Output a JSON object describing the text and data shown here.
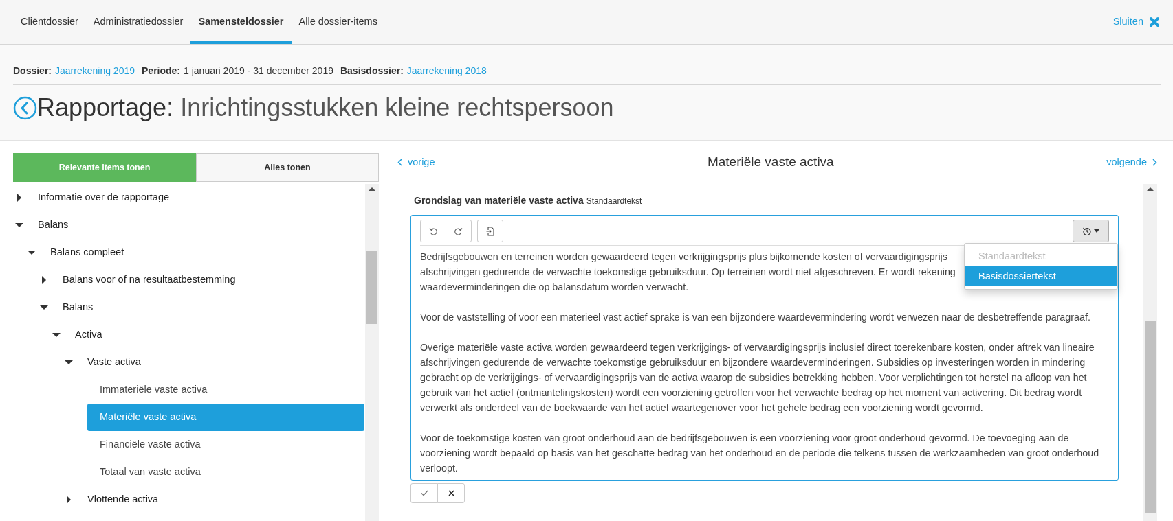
{
  "nav": {
    "tabs": [
      {
        "label": "Cliëntdossier",
        "selected": false
      },
      {
        "label": "Administratiedossier",
        "selected": false
      },
      {
        "label": "Samensteldossier",
        "selected": true
      },
      {
        "label": "Alle dossier-items",
        "selected": false
      }
    ],
    "close": "Sluiten"
  },
  "meta": [
    {
      "label": "Dossier:",
      "value": "Jaarrekening 2019",
      "kind": "link"
    },
    {
      "label": "Periode:",
      "value": "1 januari 2019 - 31 december 2019",
      "kind": "text"
    },
    {
      "label": "Basisdossier:",
      "value": "Jaarrekening 2018",
      "kind": "link"
    }
  ],
  "title": {
    "prefix": "Rapportage:",
    "text": "Inrichtingsstukken kleine rechtspersoon"
  },
  "filter": [
    {
      "label": "Relevante items tonen",
      "selected": true
    },
    {
      "label": "Alles tonen",
      "selected": false
    }
  ],
  "tree": [
    {
      "label": "Informatie over de rapportage",
      "kind": "group",
      "expanded": false,
      "selected": false
    },
    {
      "label": "Balans",
      "kind": "group",
      "expanded": true,
      "selected": false,
      "children": [
        {
          "label": "Balans compleet",
          "kind": "group",
          "expanded": true,
          "selected": false,
          "children": [
            {
              "label": "Balans voor of na resultaatbestemming",
              "kind": "group",
              "expanded": false,
              "selected": false
            },
            {
              "label": "Balans",
              "kind": "group",
              "expanded": true,
              "selected": false,
              "children": [
                {
                  "label": "Activa",
                  "kind": "group",
                  "expanded": true,
                  "selected": false,
                  "children": [
                    {
                      "label": "Vaste activa",
                      "kind": "group",
                      "expanded": true,
                      "selected": false,
                      "children": [
                        {
                          "label": "Immateriële vaste activa",
                          "kind": "leaf",
                          "selected": false
                        },
                        {
                          "label": "Materiële vaste activa",
                          "kind": "leaf",
                          "selected": true
                        },
                        {
                          "label": "Financiële vaste activa",
                          "kind": "leaf",
                          "selected": false
                        },
                        {
                          "label": "Totaal van vaste activa",
                          "kind": "leaf",
                          "selected": false
                        }
                      ]
                    },
                    {
                      "label": "Vlottende activa",
                      "kind": "group",
                      "expanded": false,
                      "selected": false
                    }
                  ]
                }
              ]
            }
          ]
        }
      ]
    }
  ],
  "pager": {
    "previous": "vorige",
    "title": "Materiële vaste activa",
    "next": "volgende"
  },
  "section": {
    "title": "Grondslag van materiële vaste activa",
    "source": "Standaardtekst"
  },
  "editor": {
    "paragraphs": [
      {
        "lines": [
          "Bedrijfsgebouwen en terreinen worden gewaardeerd tegen verkrijgingsprijs plus bijkomende kosten of vervaardigingsprijs",
          "afschrijvingen gedurende de verwachte toekomstige gebruiksduur. Op terreinen wordt niet afgeschreven. Er wordt rekening",
          "waardeverminderingen die op balansdatum worden verwacht."
        ]
      },
      {
        "lines": [
          "Voor de vaststelling of voor een materieel vast actief sprake is van een bijzondere waardevermindering wordt verwezen naar de desbetreffende paragraaf."
        ]
      },
      {
        "lines": [
          "Overige materiële vaste activa worden gewaardeerd tegen verkrijgings- of vervaardigingsprijs inclusief direct toerekenbare kosten, onder aftrek van lineaire",
          "afschrijvingen gedurende de verwachte toekomstige gebruiksduur en bijzondere waardeverminderingen. Subsidies op investeringen worden in mindering",
          "gebracht op de verkrijgings- of vervaardigingsprijs van de activa waarop de subsidies betrekking hebben. Voor verplichtingen tot herstel na afloop van het",
          "gebruik van het actief (ontmantelingskosten) wordt een voorziening getroffen voor het verwachte bedrag op het moment van activering. Dit bedrag wordt",
          "verwerkt als onderdeel van de boekwaarde van het actief waartegenover voor het gehele bedrag een voorziening wordt gevormd."
        ]
      },
      {
        "lines": [
          "Voor de toekomstige kosten van groot onderhoud aan de bedrijfsgebouwen is een voorziening voor groot onderhoud gevormd. De toevoeging aan de",
          "voorziening wordt bepaald op basis van het geschatte bedrag van het onderhoud en de periode die telkens tussen de werkzaamheden van groot onderhoud",
          "verloopt."
        ]
      }
    ]
  },
  "history_menu": {
    "items": [
      {
        "label": "Standaardtekst",
        "disabled": true,
        "selected": false
      },
      {
        "label": "Basisdossiertekst",
        "disabled": false,
        "selected": true
      }
    ]
  }
}
